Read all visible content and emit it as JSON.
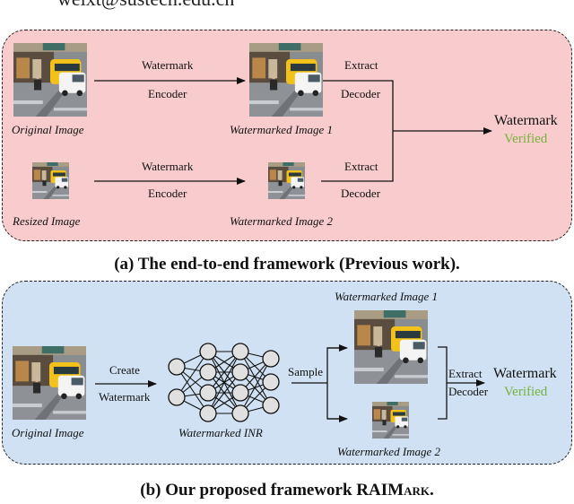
{
  "header": {
    "email_fragment": "weixt@sustech.edu.cn"
  },
  "panel_a": {
    "caption": "(a) The end-to-end framework (Previous work).",
    "original_image_label": "Original Image",
    "resized_image_label": "Resized Image",
    "watermarked_image_1_label": "Watermarked Image 1",
    "watermarked_image_2_label": "Watermarked Image 2",
    "encoder_top_1": "Watermark",
    "encoder_bottom_1": "Encoder",
    "encoder_top_2": "Watermark",
    "encoder_bottom_2": "Encoder",
    "decoder_top_1": "Extract",
    "decoder_bottom_1": "Decoder",
    "decoder_top_2": "Extract",
    "decoder_bottom_2": "Decoder",
    "result_line1": "Watermark",
    "result_line2": "Verified"
  },
  "panel_b": {
    "caption_prefix": "(b) Our proposed framework RAI",
    "caption_sc": "Mark",
    "caption_suffix": ".",
    "original_image_label": "Original Image",
    "create_top": "Create",
    "create_bottom": "Watermark",
    "inr_label": "Watermarked INR",
    "sample_label": "Sample",
    "watermarked_image_1_label": "Watermarked Image 1",
    "watermarked_image_2_label": "Watermarked Image 2",
    "decoder_top": "Extract",
    "decoder_bottom": "Decoder",
    "result_line1": "Watermark",
    "result_line2": "Verified"
  },
  "colors": {
    "panel_a_bg": "#f8cccc",
    "panel_b_bg": "#cfe1f2",
    "verified_green": "#78b13f",
    "node_fill": "#e0e0e0"
  }
}
